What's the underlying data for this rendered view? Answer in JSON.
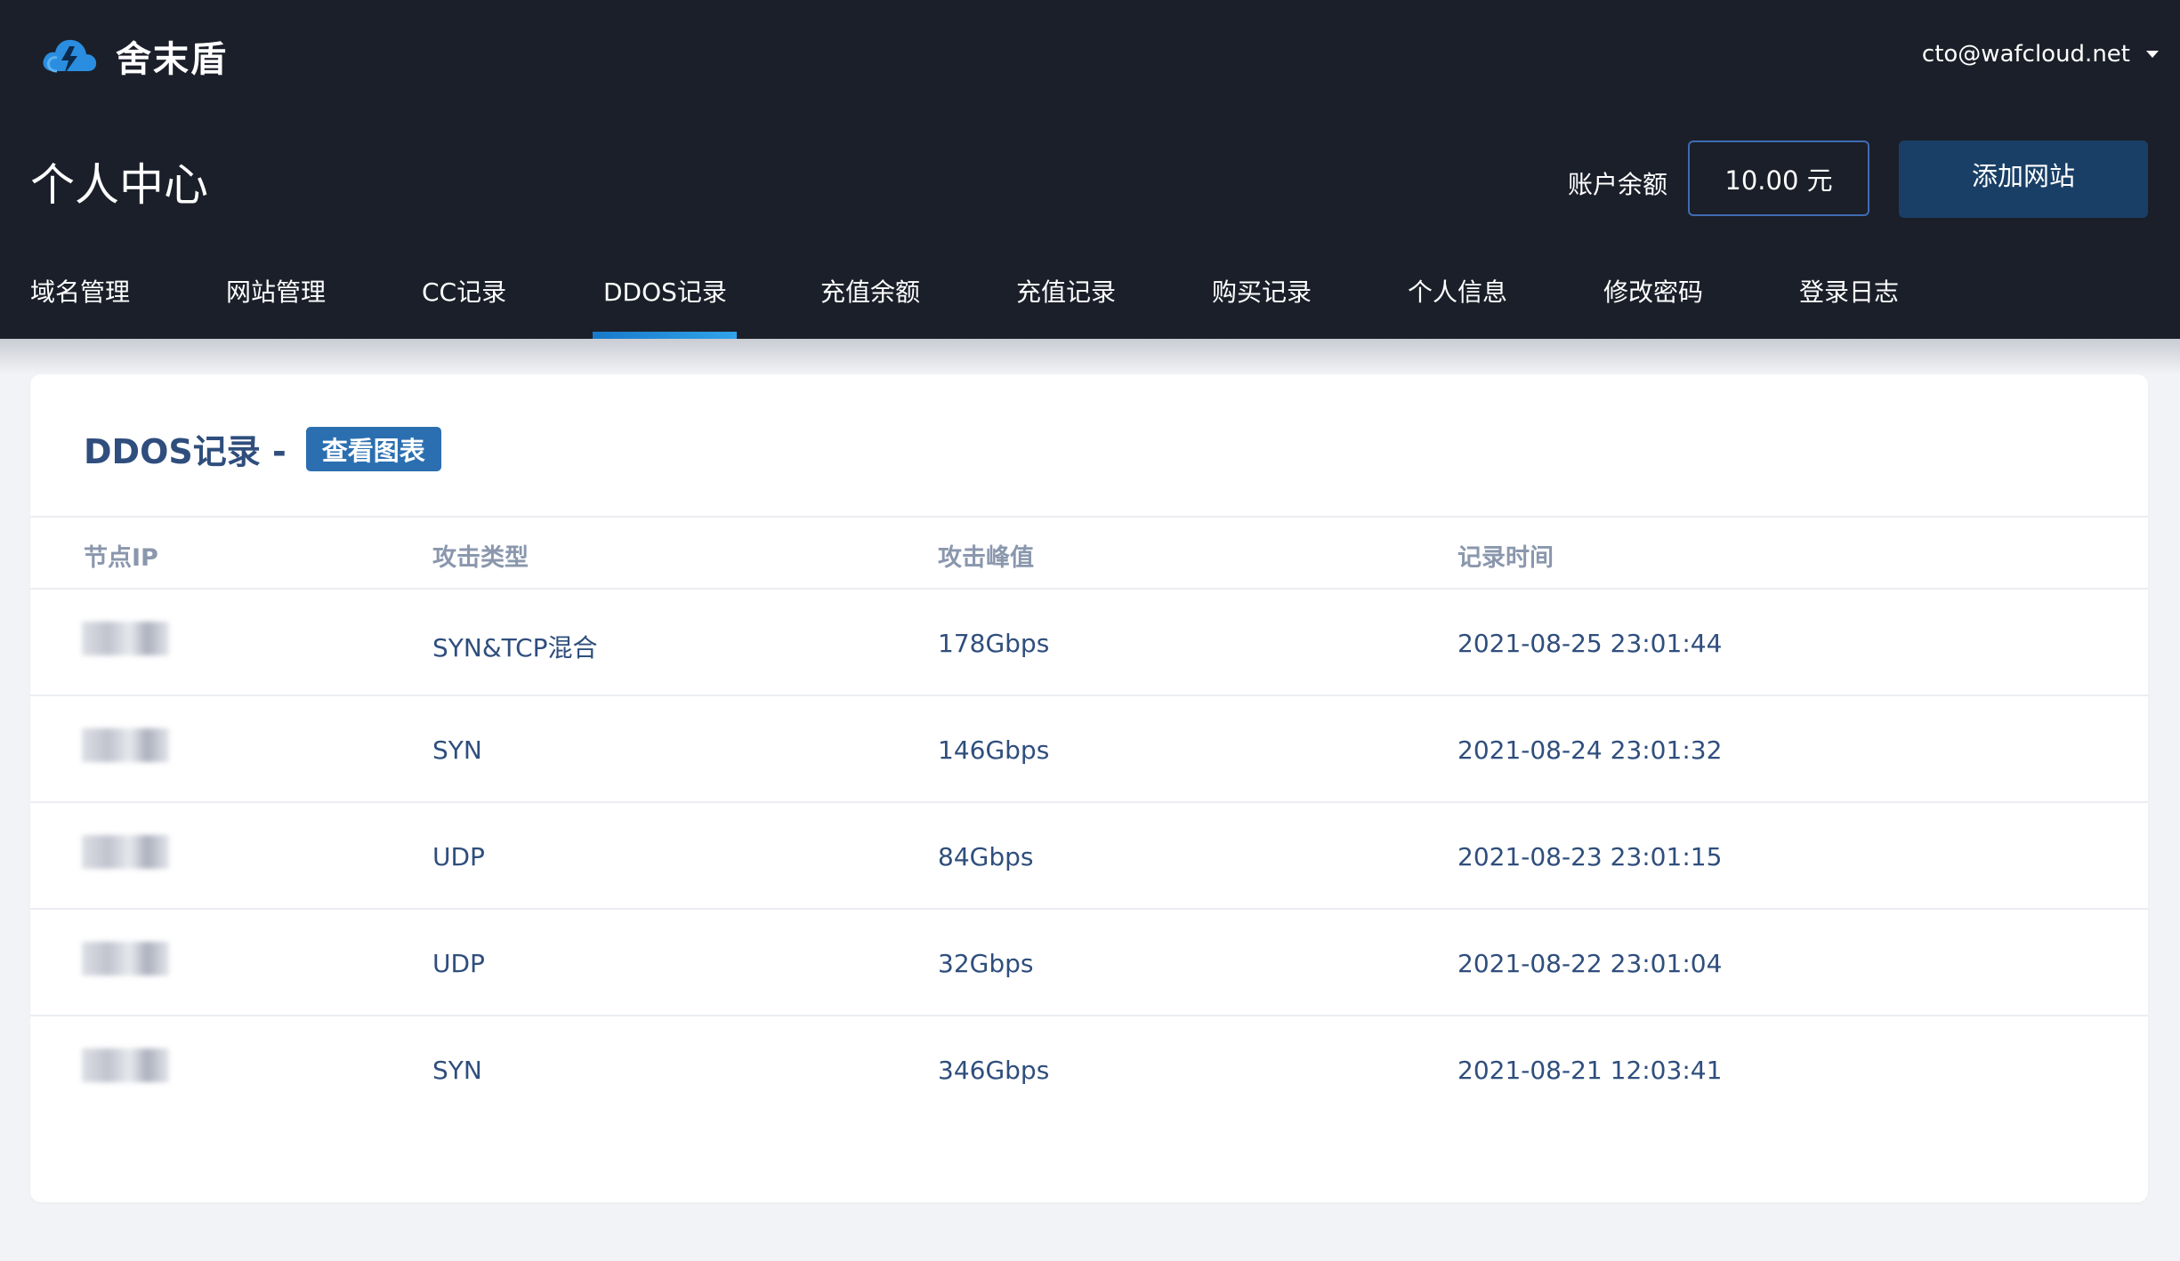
{
  "brand": {
    "name": "舍末盾",
    "icon": "cloud-lightning-icon",
    "accent": "#2a8de0"
  },
  "user": {
    "email": "cto@wafcloud.net"
  },
  "page": {
    "title": "个人中心"
  },
  "account": {
    "balance_label": "账户余额",
    "balance_value": "10.00 元",
    "add_site_label": "添加网站"
  },
  "tabs": [
    {
      "label": "域名管理",
      "active": false
    },
    {
      "label": "网站管理",
      "active": false
    },
    {
      "label": "CC记录",
      "active": false
    },
    {
      "label": "DDOS记录",
      "active": true
    },
    {
      "label": "充值余额",
      "active": false
    },
    {
      "label": "充值记录",
      "active": false
    },
    {
      "label": "购买记录",
      "active": false
    },
    {
      "label": "个人信息",
      "active": false
    },
    {
      "label": "修改密码",
      "active": false
    },
    {
      "label": "登录日志",
      "active": false
    }
  ],
  "card": {
    "title": "DDOS记录 -",
    "chart_button_label": "查看图表"
  },
  "table": {
    "columns": [
      "节点IP",
      "攻击类型",
      "攻击峰值",
      "记录时间"
    ],
    "rows": [
      {
        "ip": "",
        "type": "SYN&TCP混合",
        "peak": "178Gbps",
        "time": "2021-08-25 23:01:44"
      },
      {
        "ip": "",
        "type": "SYN",
        "peak": "146Gbps",
        "time": "2021-08-24 23:01:32"
      },
      {
        "ip": "",
        "type": "UDP",
        "peak": "84Gbps",
        "time": "2021-08-23 23:01:15"
      },
      {
        "ip": "",
        "type": "UDP",
        "peak": "32Gbps",
        "time": "2021-08-22 23:01:04"
      },
      {
        "ip": "",
        "type": "SYN",
        "peak": "346Gbps",
        "time": "2021-08-21 12:03:41"
      }
    ]
  },
  "colors": {
    "header_bg": "#1b1f29",
    "button_bg": "#1a3f66",
    "tab_underline": "#1f8be0",
    "chart_button": "#2b6fb0"
  }
}
